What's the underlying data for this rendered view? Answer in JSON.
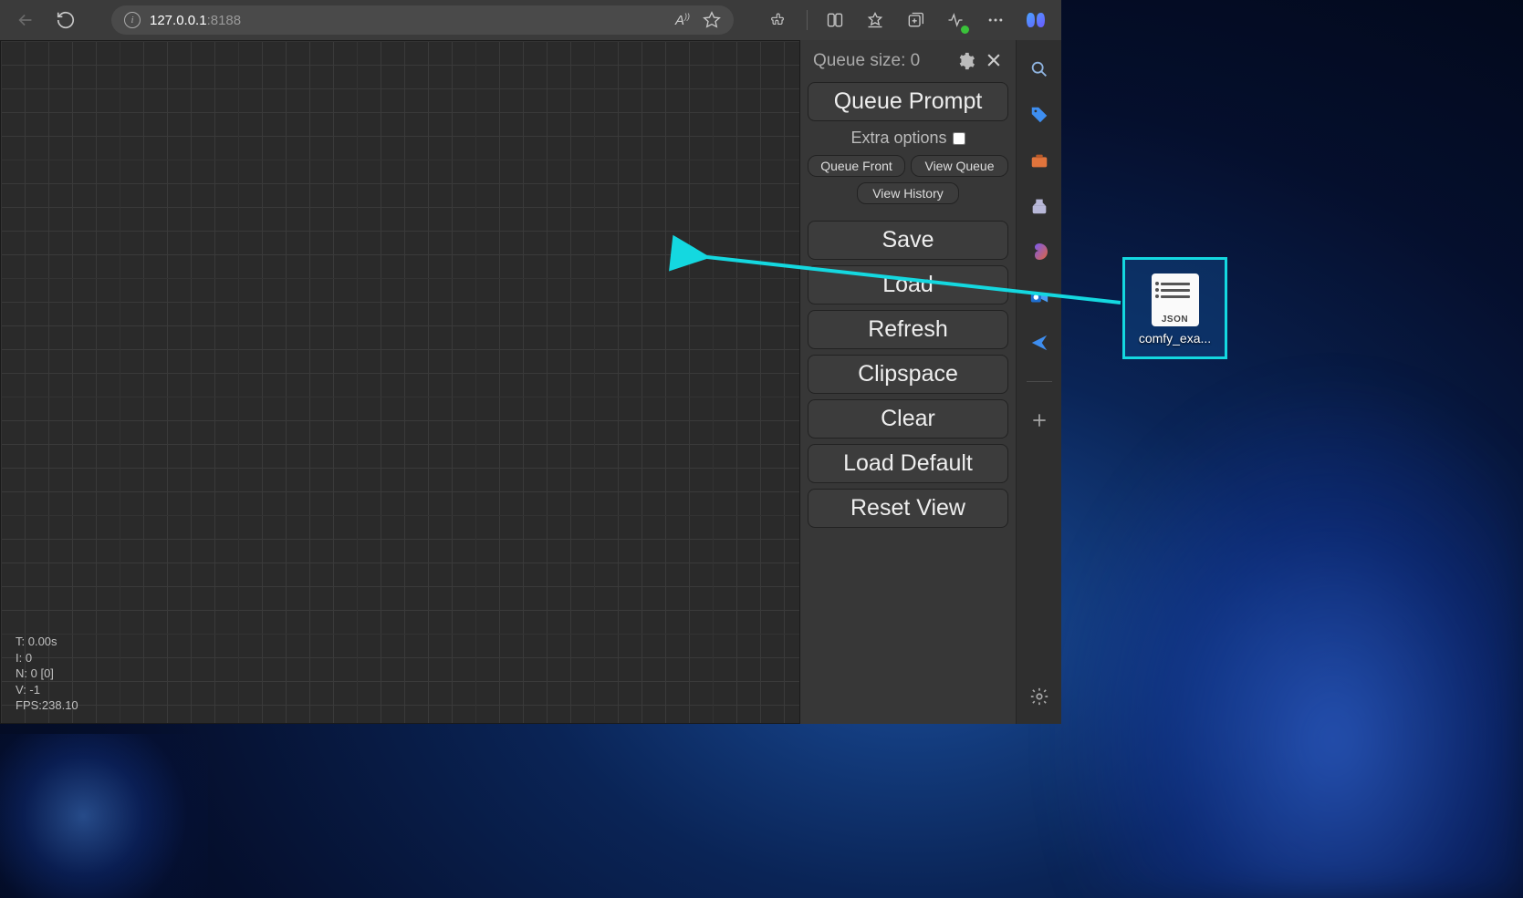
{
  "browser": {
    "url_host": "127.0.0.1",
    "url_port": ":8188"
  },
  "panel": {
    "queue_label": "Queue size: 0",
    "extra_options": "Extra options",
    "buttons": {
      "queue_prompt": "Queue Prompt",
      "queue_front": "Queue Front",
      "view_queue": "View Queue",
      "view_history": "View History",
      "save": "Save",
      "load": "Load",
      "refresh": "Refresh",
      "clipspace": "Clipspace",
      "clear": "Clear",
      "load_default": "Load Default",
      "reset_view": "Reset View"
    }
  },
  "canvas_stats": {
    "t": "T: 0.00s",
    "i": "I: 0",
    "n": "N: 0 [0]",
    "v": "V: -1",
    "fps": "FPS:238.10"
  },
  "desktop_file": {
    "ext_label": "JSON",
    "name": "comfy_exa..."
  }
}
